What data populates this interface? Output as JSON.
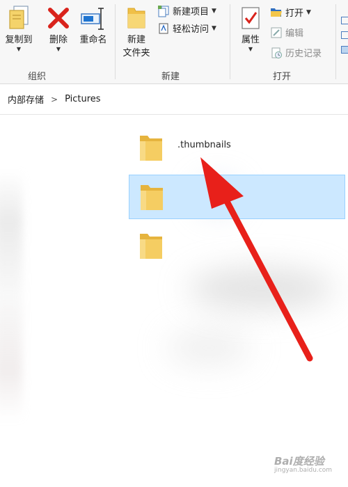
{
  "ribbon": {
    "organize": {
      "label": "组织",
      "copy_to": "复制到",
      "delete": "删除",
      "rename": "重命名"
    },
    "new": {
      "label": "新建",
      "new_folder_line1": "新建",
      "new_folder_line2": "文件夹",
      "new_item": "新建项目",
      "easy_access": "轻松访问"
    },
    "open": {
      "label": "打开",
      "properties": "属性",
      "open": "打开",
      "edit": "编辑",
      "history": "历史记录"
    }
  },
  "address": {
    "crumbs": [
      "内部存储",
      "Pictures"
    ]
  },
  "files": [
    {
      "name": ".thumbnails",
      "selected": false
    },
    {
      "name": "",
      "selected": true
    },
    {
      "name": "",
      "selected": false
    }
  ],
  "watermark": {
    "main": "Bai度经验",
    "sub": "jingyan.baidu.com"
  },
  "colors": {
    "accent_red": "#e8201a",
    "folder_yellow": "#f5cd62",
    "selection_bg": "#cce8ff",
    "selection_border": "#99d1ff"
  },
  "icons": [
    "copy-to-icon",
    "delete-icon",
    "rename-icon",
    "new-folder-icon",
    "new-item-icon",
    "easy-access-icon",
    "properties-icon",
    "open-icon",
    "edit-icon",
    "history-icon",
    "folder-icon",
    "red-arrow-icon"
  ]
}
